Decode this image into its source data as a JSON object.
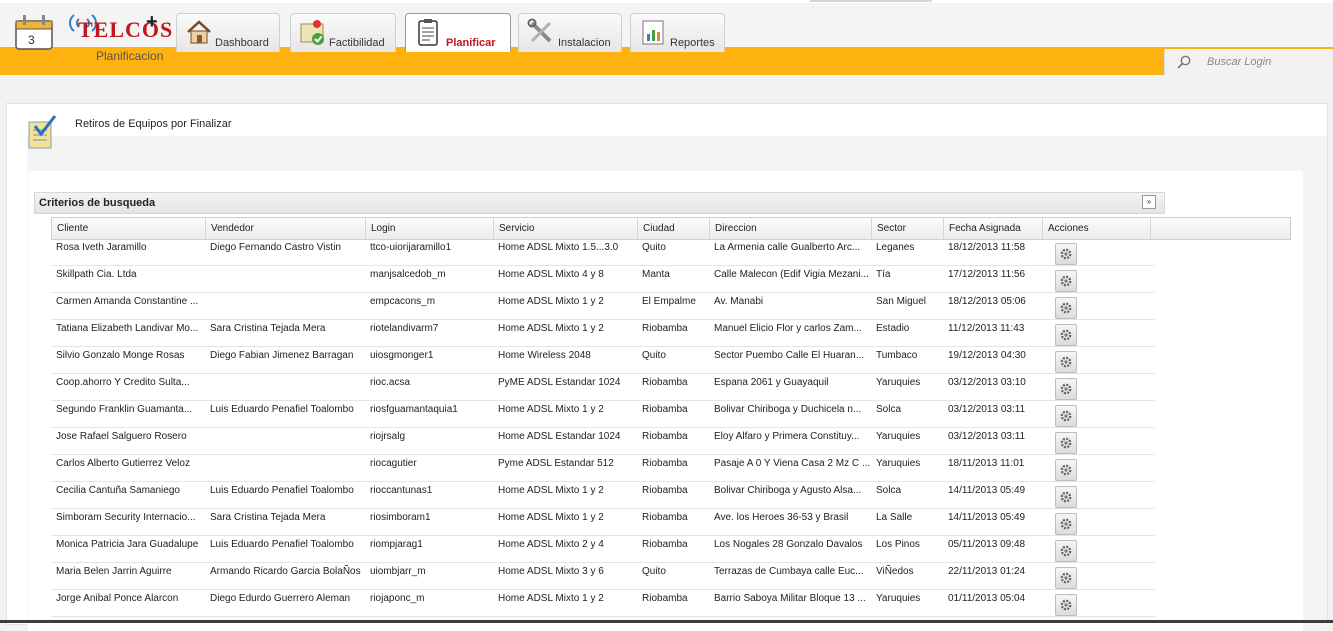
{
  "app": {
    "logo_text": "TELCOS",
    "logo_plus": "+",
    "subtitle": "Planificacion"
  },
  "nav": {
    "tabs": [
      {
        "label": "Dashboard"
      },
      {
        "label": "Factibilidad"
      },
      {
        "label": "Planificar",
        "active": true
      },
      {
        "label": "Instalacion"
      },
      {
        "label": "Reportes"
      }
    ]
  },
  "search": {
    "placeholder": "Buscar Login"
  },
  "page": {
    "title": "Retiros de Equipos por Finalizar"
  },
  "criteria": {
    "title": "Criterios de busqueda"
  },
  "table": {
    "columns": [
      "Cliente",
      "Vendedor",
      "Login",
      "Servicio",
      "Ciudad",
      "Direccion",
      "Sector",
      "Fecha Asignada",
      "Acciones"
    ],
    "rows": [
      [
        "Rosa Iveth Jaramillo",
        "Diego Fernando Castro Vistin",
        "ttco-uiorijaramillo1",
        "Home ADSL Mixto 1.5...3.0",
        "Quito",
        "La Armenia calle Gualberto Arc...",
        "Leganes",
        "18/12/2013 11:58"
      ],
      [
        "Skillpath Cia. Ltda",
        "",
        "manjsalcedob_m",
        "Home ADSL Mixto 4 y 8",
        "Manta",
        "Calle Malecon (Edif Vigia Mezani...",
        "Tía",
        "17/12/2013 11:56"
      ],
      [
        "Carmen Amanda Constantine ...",
        "",
        "empcacons_m",
        "Home ADSL Mixto 1 y 2",
        "El Empalme",
        "Av. Manabi",
        "San Miguel",
        "18/12/2013 05:06"
      ],
      [
        "Tatiana Elizabeth Landivar Mo...",
        "Sara Cristina Tejada Mera",
        "riotelandivarm7",
        "Home ADSL Mixto 1 y 2",
        "Riobamba",
        "Manuel Elicio Flor y carlos Zam...",
        "Estadio",
        "11/12/2013 11:43"
      ],
      [
        "Silvio Gonzalo Monge Rosas",
        "Diego Fabian Jimenez Barragan",
        "uiosgmonger1",
        "Home Wireless 2048",
        "Quito",
        "Sector Puembo Calle El Huaran...",
        "Tumbaco",
        "19/12/2013 04:30"
      ],
      [
        "Coop.ahorro Y Credito Sulta...",
        "",
        "rioc.acsa",
        "PyME ADSL Estandar 1024",
        "Riobamba",
        "Espana 2061 y Guayaquil",
        "Yaruquies",
        "03/12/2013 03:10"
      ],
      [
        "Segundo Franklin Guamanta...",
        "Luis Eduardo Penafiel Toalombo",
        "riosfguamantaquia1",
        "Home ADSL Mixto 1 y 2",
        "Riobamba",
        "Bolivar Chiriboga y Duchicela n...",
        "Solca",
        "03/12/2013 03:11"
      ],
      [
        "Jose Rafael Salguero Rosero",
        "",
        "riojrsalg",
        "Home ADSL Estandar 1024",
        "Riobamba",
        "Eloy Alfaro y Primera Constituy...",
        "Yaruquies",
        "03/12/2013 03:11"
      ],
      [
        "Carlos Alberto Gutierrez Veloz",
        "",
        "riocagutier",
        "Pyme ADSL Estandar 512",
        "Riobamba",
        "Pasaje A 0 Y Viena Casa 2 Mz C ...",
        "Yaruquies",
        "18/11/2013 11:01"
      ],
      [
        "Cecilia Cantuña Samaniego",
        "Luis Eduardo Penafiel Toalombo",
        "rioccantunas1",
        "Home ADSL Mixto 1 y 2",
        "Riobamba",
        "Bolivar Chiriboga y Agusto Alsa...",
        "Solca",
        "14/11/2013 05:49"
      ],
      [
        "Simboram Security Internacio...",
        "Sara Cristina Tejada Mera",
        "riosimboram1",
        "Home ADSL Mixto 1 y 2",
        "Riobamba",
        "Ave. los Heroes 36-53 y Brasil",
        "La Salle",
        "14/11/2013 05:49"
      ],
      [
        "Monica Patricia Jara Guadalupe",
        "Luis Eduardo Penafiel Toalombo",
        "riompjarag1",
        "Home ADSL Mixto 2 y 4",
        "Riobamba",
        "Los Nogales 28 Gonzalo Davalos",
        "Los Pinos",
        "05/11/2013 09:48"
      ],
      [
        "Maria Belen Jarrin Aguirre",
        "Armando Ricardo Garcia BolaÑos",
        "uiombjarr_m",
        "Home ADSL Mixto 3 y 6",
        "Quito",
        "Terrazas de Cumbaya calle Euc...",
        "ViÑedos",
        "22/11/2013 01:24"
      ],
      [
        "Jorge Anibal Ponce Alarcon",
        "Diego Edurdo Guerrero Aleman",
        "riojaponc_m",
        "Home ADSL Mixto 1 y 2",
        "Riobamba",
        "Barrio Saboya Militar Bloque 13 ...",
        "Yaruquies",
        "01/11/2013 05:04"
      ]
    ]
  }
}
